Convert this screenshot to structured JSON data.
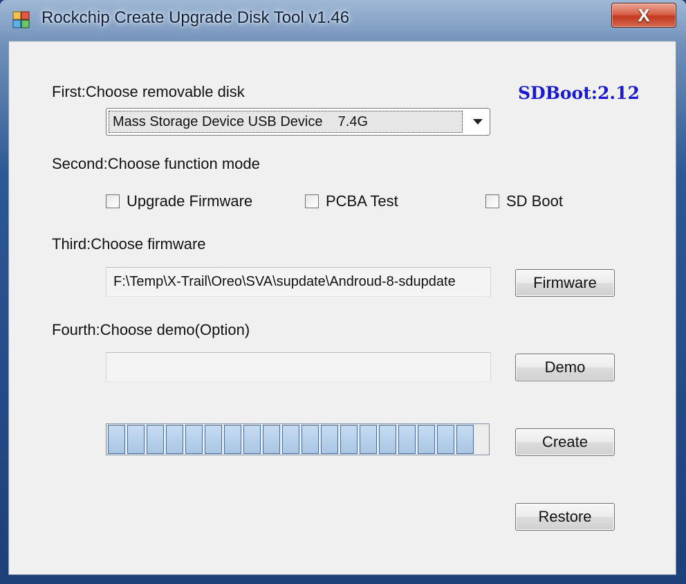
{
  "window": {
    "title": "Rockchip Create Upgrade Disk Tool v1.46",
    "close_glyph": "X",
    "app_icon": "app-blocks-icon"
  },
  "sdboot_version": "SDBoot:2.12",
  "step1": {
    "label": "First:Choose removable disk",
    "selected_disk": "Mass Storage Device USB Device    7.4G"
  },
  "step2": {
    "label": "Second:Choose function mode",
    "options": [
      {
        "label": "Upgrade Firmware",
        "checked": false
      },
      {
        "label": "PCBA Test",
        "checked": false
      },
      {
        "label": "SD Boot",
        "checked": false
      }
    ]
  },
  "step3": {
    "label": "Third:Choose firmware",
    "path": "F:\\Temp\\X-Trail\\Oreo\\SVA\\supdate\\Androud-8-sdupdate",
    "button_label": "Firmware"
  },
  "step4": {
    "label": "Fourth:Choose demo(Option)",
    "path": "",
    "button_label": "Demo"
  },
  "progress": {
    "fraction": 1.0,
    "segments": 19
  },
  "actions": {
    "create_label": "Create",
    "restore_label": "Restore"
  },
  "colors": {
    "sdboot_text": "#1a1ad0",
    "progress_fill": "#a9c6e4",
    "close_button": "#c23a1e"
  }
}
